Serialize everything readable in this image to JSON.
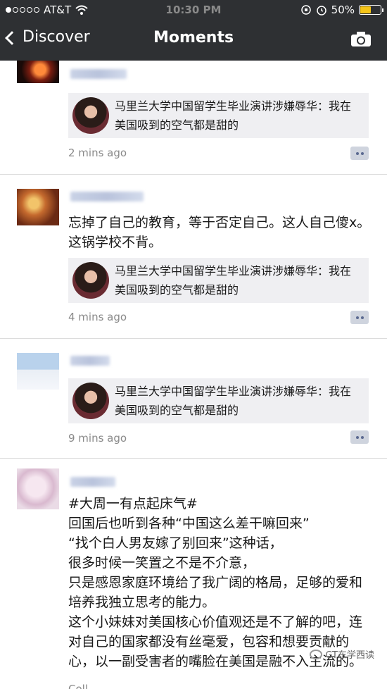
{
  "status_bar": {
    "carrier": "AT&T",
    "time": "10:30 PM",
    "battery": "50%"
  },
  "nav": {
    "back_label": "Discover",
    "title": "Moments"
  },
  "posts": [
    {
      "text": "",
      "share_title": "马里兰大学中国留学生毕业演讲涉嫌辱华：我在美国吸到的空气都是甜的",
      "time": "2 mins ago"
    },
    {
      "text": "忘掉了自己的教育，等于否定自己。这人自己傻x。这锅学校不背。",
      "share_title": "马里兰大学中国留学生毕业演讲涉嫌辱华：我在美国吸到的空气都是甜的",
      "time": "4 mins ago"
    },
    {
      "text": "",
      "share_title": "马里兰大学中国留学生毕业演讲涉嫌辱华：我在美国吸到的空气都是甜的",
      "time": "9 mins ago"
    },
    {
      "text": "#大周一有点起床气#\n回国后也听到各种“中国这么差干嘛回来”\n“找个白人男友嫁了别回来”这种话，\n很多时候一笑置之不是不介意，\n只是感恩家庭环境给了我广阔的格局，足够的爱和培养我独立思考的能力。\n这个小妹妹对美国核心价值观还是不了解的吧，连对自己的国家都没有丝毫爱，包容和想要贡献的心，以一副受害者的嘴脸在美国是融不入主流的。",
      "time": "Coll"
    }
  ],
  "watermark": "GT东学西读"
}
